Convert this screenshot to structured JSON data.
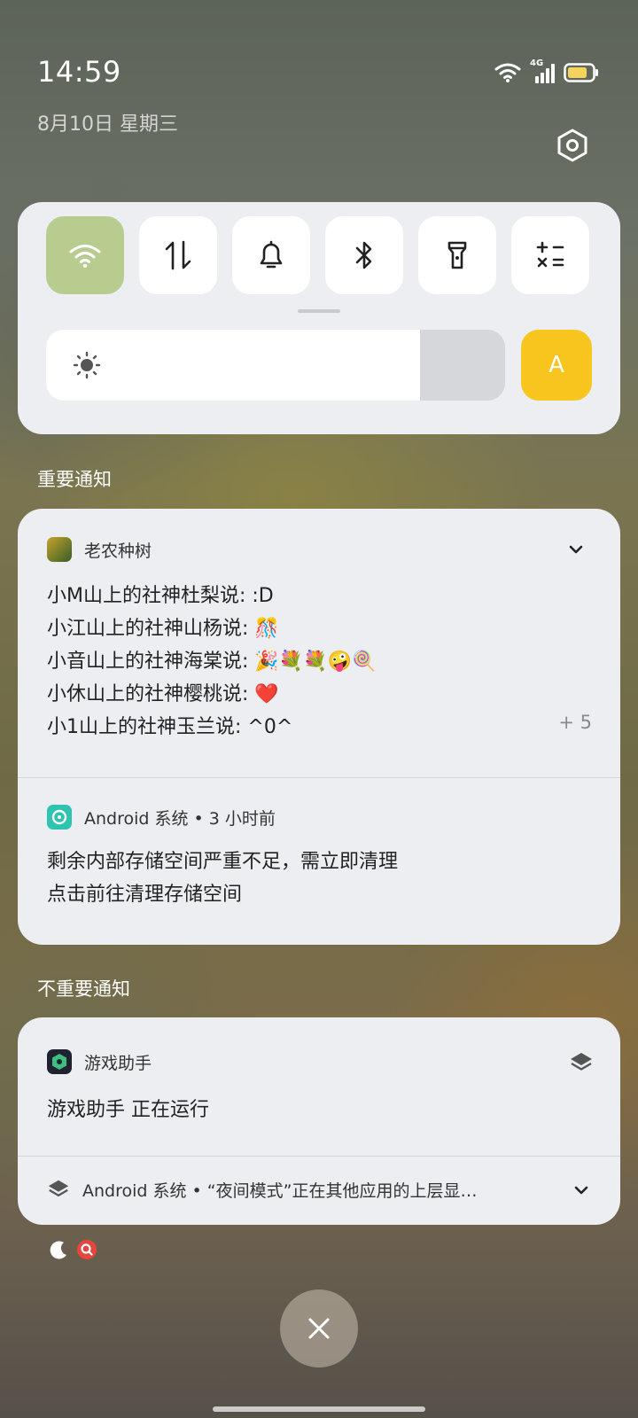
{
  "status_bar": {
    "time": "14:59",
    "date": "8月10日  星期三",
    "network_label": "4G",
    "icons": [
      "wifi-icon",
      "signal-icon",
      "battery-icon"
    ]
  },
  "quick_settings": {
    "tiles": [
      {
        "name": "wifi",
        "icon": "wifi-icon",
        "active": true
      },
      {
        "name": "mobile-data",
        "icon": "data-arrows-icon",
        "active": false
      },
      {
        "name": "ringer",
        "icon": "bell-icon",
        "active": false
      },
      {
        "name": "bluetooth",
        "icon": "bluetooth-icon",
        "active": false
      },
      {
        "name": "flashlight",
        "icon": "flashlight-icon",
        "active": false
      },
      {
        "name": "calculator",
        "icon": "calculator-icon",
        "active": false
      }
    ],
    "brightness_level": 0.815,
    "auto_label": "A",
    "colors": {
      "active_tile": "#b9cc90",
      "auto_button": "#f8c51f"
    }
  },
  "important_section": {
    "title": "重要通知",
    "notifications": [
      {
        "app_name": "老农种树",
        "lines": [
          "小M山上的社神杜梨说: :D",
          "小江山上的社神山杨说: 🎊",
          "小音山上的社神海棠说: 🎉💐💐🤪🍭",
          "小休山上的社神樱桃说: ❤️",
          "小1山上的社神玉兰说: ^0^"
        ],
        "more_count": "+ 5"
      },
      {
        "app_name": "Android 系统 • 3 小时前",
        "lines": [
          "剩余内部存储空间严重不足，需立即清理",
          "点击前往清理存储空间"
        ]
      }
    ]
  },
  "unimportant_section": {
    "title": "不重要通知",
    "notifications": [
      {
        "app_name": "游戏助手",
        "lines": [
          "游戏助手 正在运行"
        ]
      },
      {
        "app_name": "Android 系统 • “夜间模式”正在其他应用的上层显…"
      }
    ]
  }
}
